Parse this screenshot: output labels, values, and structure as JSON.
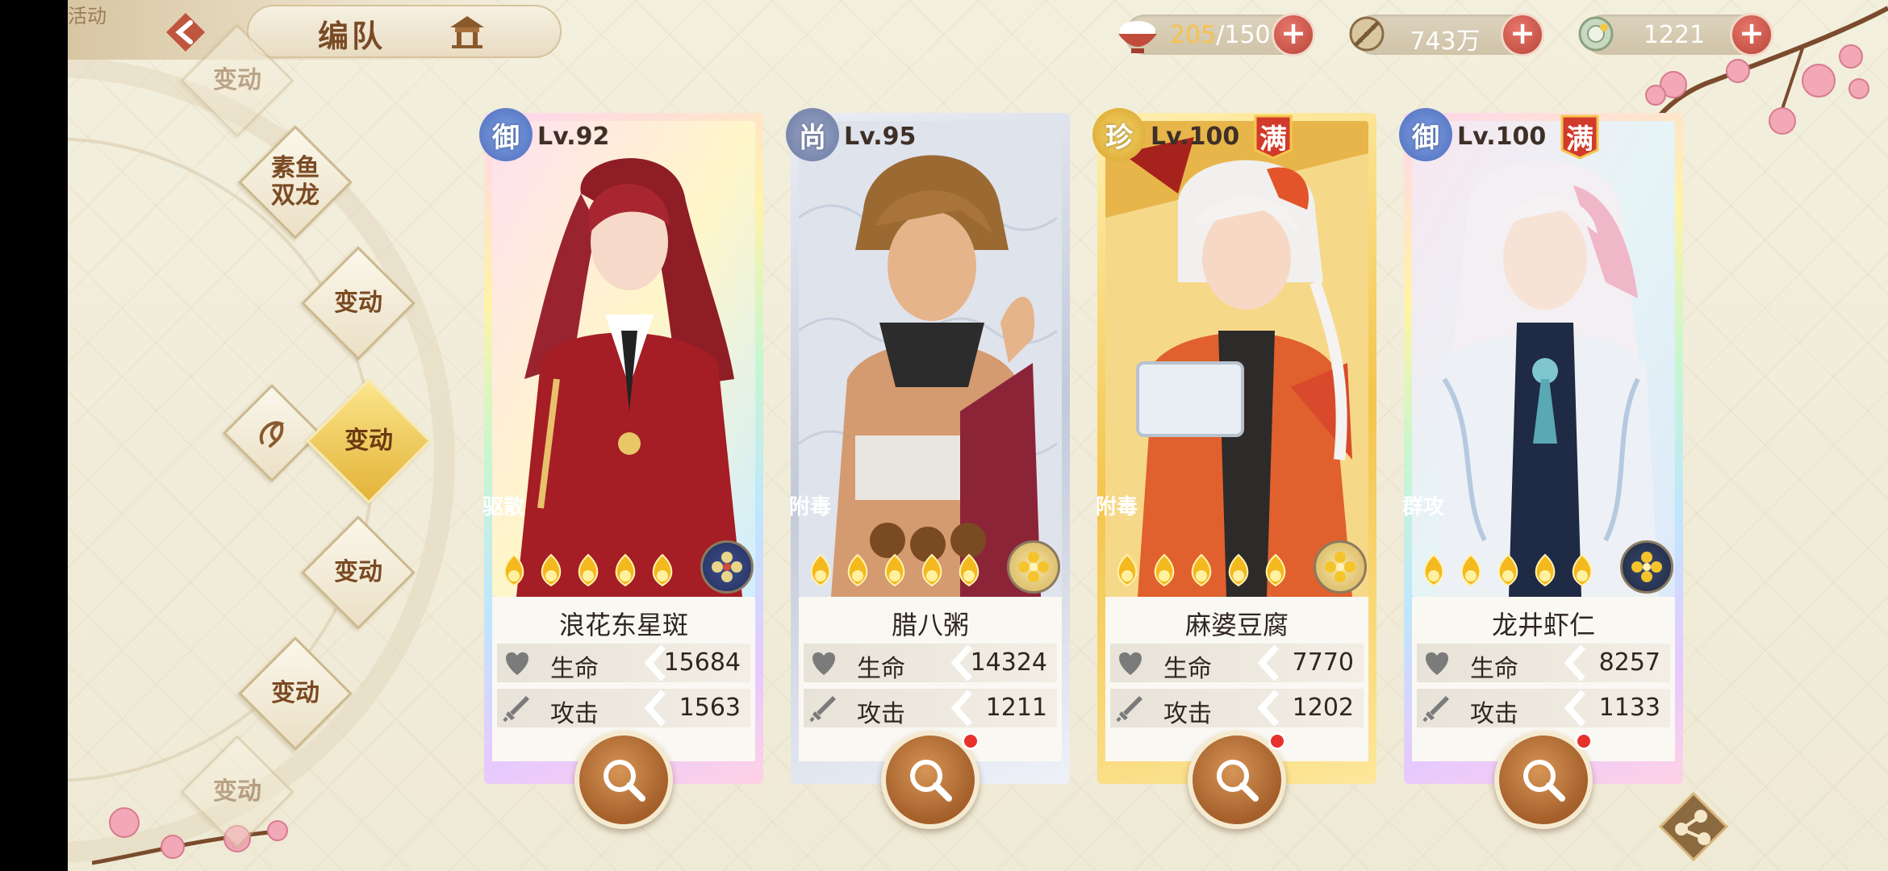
{
  "header": {
    "title": "编队",
    "corner_text": "活动"
  },
  "resources": [
    {
      "icon": "rice-bowl-icon",
      "current": "205",
      "max": "/150"
    },
    {
      "icon": "coin-string-icon",
      "value": "743万"
    },
    {
      "icon": "jade-coin-icon",
      "value": "1221"
    }
  ],
  "formations": [
    {
      "label": "变动",
      "state": "faded"
    },
    {
      "label": "素鱼\n双龙",
      "state": "normal"
    },
    {
      "label": "变动",
      "state": "normal"
    },
    {
      "label": "变动",
      "state": "selected"
    },
    {
      "label": "变动",
      "state": "normal"
    },
    {
      "label": "变动",
      "state": "normal"
    },
    {
      "label": "变动",
      "state": "faded"
    }
  ],
  "stat_labels": {
    "hp": "生命",
    "atk": "攻击"
  },
  "cards": [
    {
      "rank": "御",
      "level": "Lv.92",
      "max": "",
      "role": "驱散",
      "name": "浪花东星斑",
      "hp": "15684",
      "atk": "1563",
      "frame": "rainbow",
      "stars": 5,
      "dot": false
    },
    {
      "rank": "尚",
      "level": "Lv.95",
      "max": "",
      "role": "附毒",
      "name": "腊八粥",
      "hp": "14324",
      "atk": "1211",
      "frame": "silver",
      "stars": 5,
      "dot": true
    },
    {
      "rank": "珍",
      "level": "Lv.100",
      "max": "满",
      "role": "附毒",
      "name": "麻婆豆腐",
      "hp": "7770",
      "atk": "1202",
      "frame": "golden",
      "stars": 5,
      "dot": true
    },
    {
      "rank": "御",
      "level": "Lv.100",
      "max": "满",
      "role": "群攻",
      "name": "龙井虾仁",
      "hp": "8257",
      "atk": "1133",
      "frame": "rainbow",
      "stars": 5,
      "dot": true
    }
  ],
  "colors": {
    "accent": "#f7c14a",
    "plus_button": "#c9544a",
    "rank_blue": "#5b7cc8"
  }
}
